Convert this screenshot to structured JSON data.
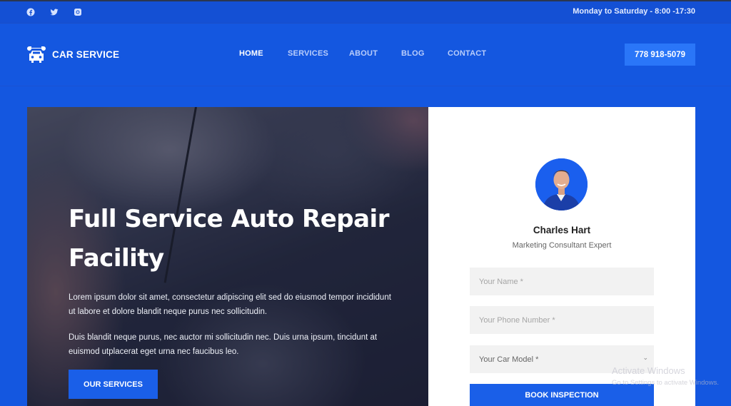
{
  "topbar": {
    "social": [
      {
        "name": "facebook-icon"
      },
      {
        "name": "twitter-icon"
      },
      {
        "name": "instagram-icon"
      }
    ],
    "hours": "Monday to Saturday - 8:00 -17:30"
  },
  "header": {
    "logo_text": "CAR SERVICE",
    "logo_icon": "car-wrench-icon",
    "nav": [
      {
        "label": "HOME",
        "active": true
      },
      {
        "label": "SERVICES",
        "active": false
      },
      {
        "label": "ABOUT",
        "active": false
      },
      {
        "label": "BLOG",
        "active": false
      },
      {
        "label": "CONTACT",
        "active": false
      }
    ],
    "phone": "778 918-5079"
  },
  "hero": {
    "title": "Full Service Auto Repair Facility",
    "paragraph1": "Lorem ipsum dolor sit amet, consectetur adipiscing elit sed do eiusmod tempor incididunt ut labore et dolore blandit neque purus nec sollicitudin.",
    "paragraph2": "Duis blandit neque purus, nec auctor mi sollicitudin nec. Duis urna ipsum, tincidunt at euismod utplacerat eget urna nec faucibus leo.",
    "button": "OUR SERVICES"
  },
  "booking_card": {
    "name": "Charles Hart",
    "role": "Marketing Consultant Expert",
    "fields": {
      "name_placeholder": "Your Name *",
      "phone_placeholder": "Your Phone Number *",
      "car_model_selected": "Your Car Model *"
    },
    "submit": "BOOK INSPECTION"
  },
  "colors": {
    "brand_blue": "#1457e0",
    "button_blue": "#1a5fe8",
    "phone_button": "#2a76f8"
  },
  "os_watermark": {
    "title": "Activate Windows",
    "subtitle": "Go to Settings to activate Windows."
  }
}
